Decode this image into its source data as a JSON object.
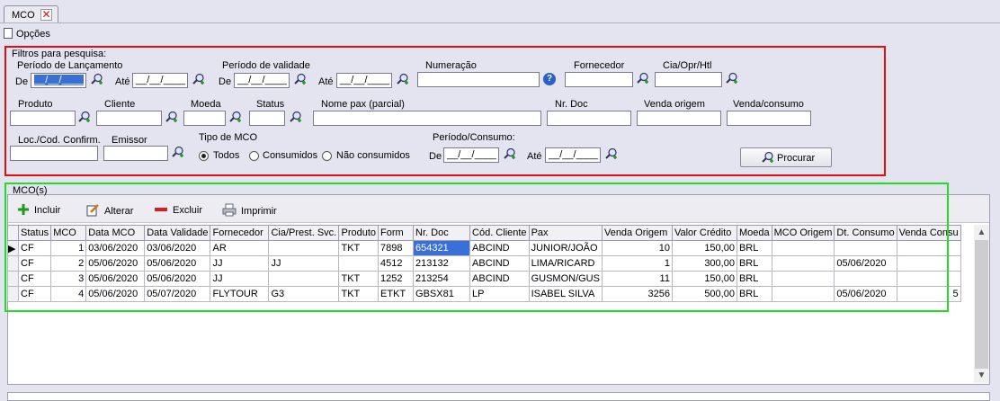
{
  "tab": {
    "label": "MCO"
  },
  "menu": {
    "opcoes": "Opções"
  },
  "filters": {
    "title": "Filtros para pesquisa:",
    "periodo_lancamento": "Período de Lançamento",
    "de": "De",
    "ate": "Até",
    "date_mask": "__/__/____",
    "periodo_validade": "Período de validade",
    "numeracao": "Numeração",
    "fornecedor": "Fornecedor",
    "cia": "Cia/Opr/Htl",
    "produto": "Produto",
    "cliente": "Cliente",
    "moeda": "Moeda",
    "status": "Status",
    "nome_pax": "Nome pax (parcial)",
    "nr_doc": "Nr. Doc",
    "venda_origem": "Venda origem",
    "venda_consumo": "Venda/consumo",
    "loc": "Loc./Cod. Confirm.",
    "emissor": "Emissor",
    "tipo_mco": "Tipo de MCO",
    "opt_todos": "Todos",
    "opt_consumidos": "Consumidos",
    "opt_nao_consumidos": "Não consumidos",
    "periodo_consumo": "Período/Consumo:",
    "procurar": "Procurar"
  },
  "panel": {
    "title": "MCO(s)"
  },
  "toolbar": {
    "incluir": "Incluir",
    "alterar": "Alterar",
    "excluir": "Excluir",
    "imprimir": "Imprimir"
  },
  "grid": {
    "columns": [
      "Status",
      "MCO",
      "Data MCO",
      "Data Validade",
      "Fornecedor",
      "Cia/Prest. Svc.",
      "Produto",
      "Form",
      "Nr. Doc",
      "Cód. Cliente",
      "Pax",
      "Venda Origem",
      "Valor Crédito",
      "Moeda",
      "MCO Origem",
      "Dt. Consumo",
      "Venda Consu"
    ],
    "rows": [
      [
        "CF",
        "1",
        "03/06/2020",
        "03/06/2020",
        "AR",
        "",
        "TKT",
        "7898",
        "654321",
        "ABCIND",
        "JUNIOR/JOÃO",
        "10",
        "150,00",
        "BRL",
        "",
        "",
        ""
      ],
      [
        "CF",
        "2",
        "05/06/2020",
        "05/06/2020",
        "JJ",
        "JJ",
        "",
        "4512",
        "213132",
        "ABCIND",
        "LIMA/RICARD",
        "1",
        "300,00",
        "BRL",
        "",
        "05/06/2020",
        ""
      ],
      [
        "CF",
        "3",
        "05/06/2020",
        "05/06/2020",
        "JJ",
        "",
        "TKT",
        "1252",
        "213254",
        "ABCIND",
        "GUSMON/GUS",
        "11",
        "150,00",
        "BRL",
        "",
        "",
        ""
      ],
      [
        "CF",
        "4",
        "05/06/2020",
        "05/07/2020",
        "FLYTOUR",
        "G3",
        "TKT",
        "ETKT",
        "GBSX81",
        "LP",
        "ISABEL SILVA",
        "3256",
        "500,00",
        "BRL",
        "",
        "05/06/2020",
        "5"
      ]
    ]
  },
  "colors": {
    "filter_frame": "#e01010",
    "grid_frame": "#22dd22",
    "selection": "#3a6fd8"
  }
}
